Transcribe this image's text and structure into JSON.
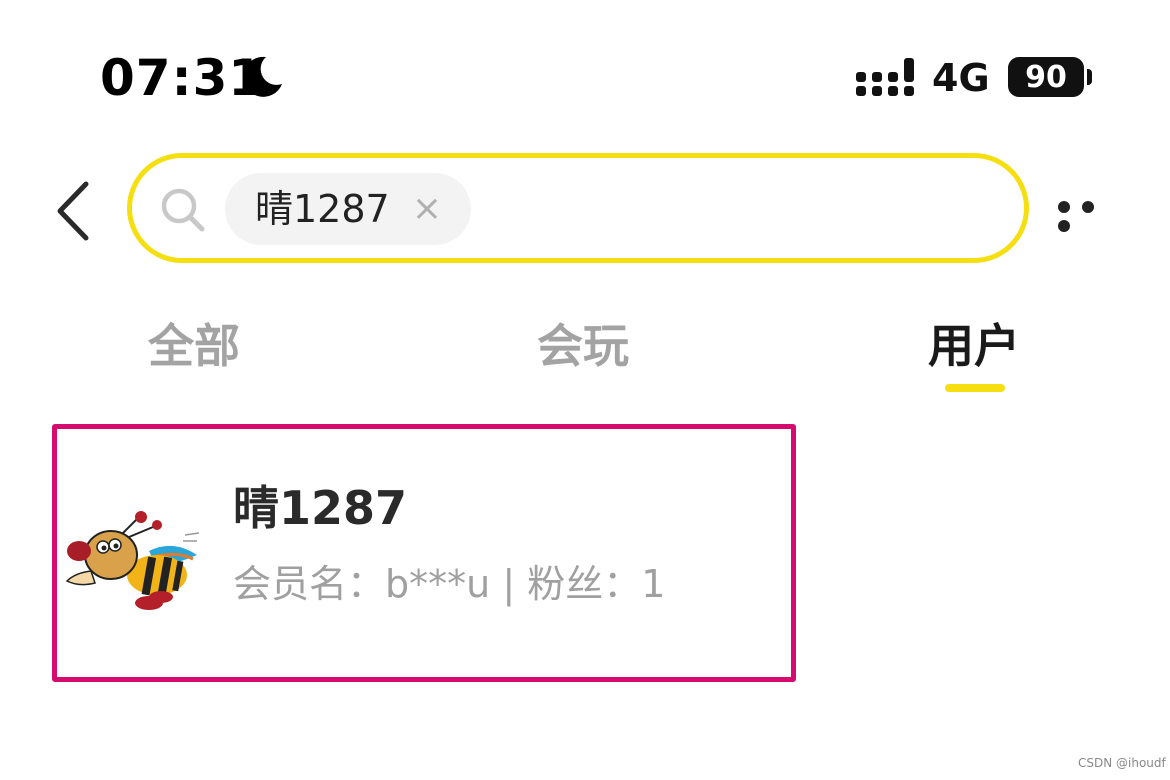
{
  "status_bar": {
    "time": "07:31",
    "network": "4G",
    "battery": "90"
  },
  "search": {
    "query": "晴1287",
    "clear_icon": "close-icon"
  },
  "tabs": [
    {
      "label": "全部",
      "active": false
    },
    {
      "label": "会玩",
      "active": false
    },
    {
      "label": "用户",
      "active": true
    }
  ],
  "results": [
    {
      "name": "晴1287",
      "member_label": "会员名：",
      "member_name": "b***u",
      "separator": "|",
      "fans_label": "粉丝：",
      "fans_count": "1"
    }
  ],
  "colors": {
    "accent": "#f5df10",
    "highlight_border": "#d60b6f",
    "muted_text": "#a0a0a0"
  },
  "watermark": "CSDN @ihoudf"
}
